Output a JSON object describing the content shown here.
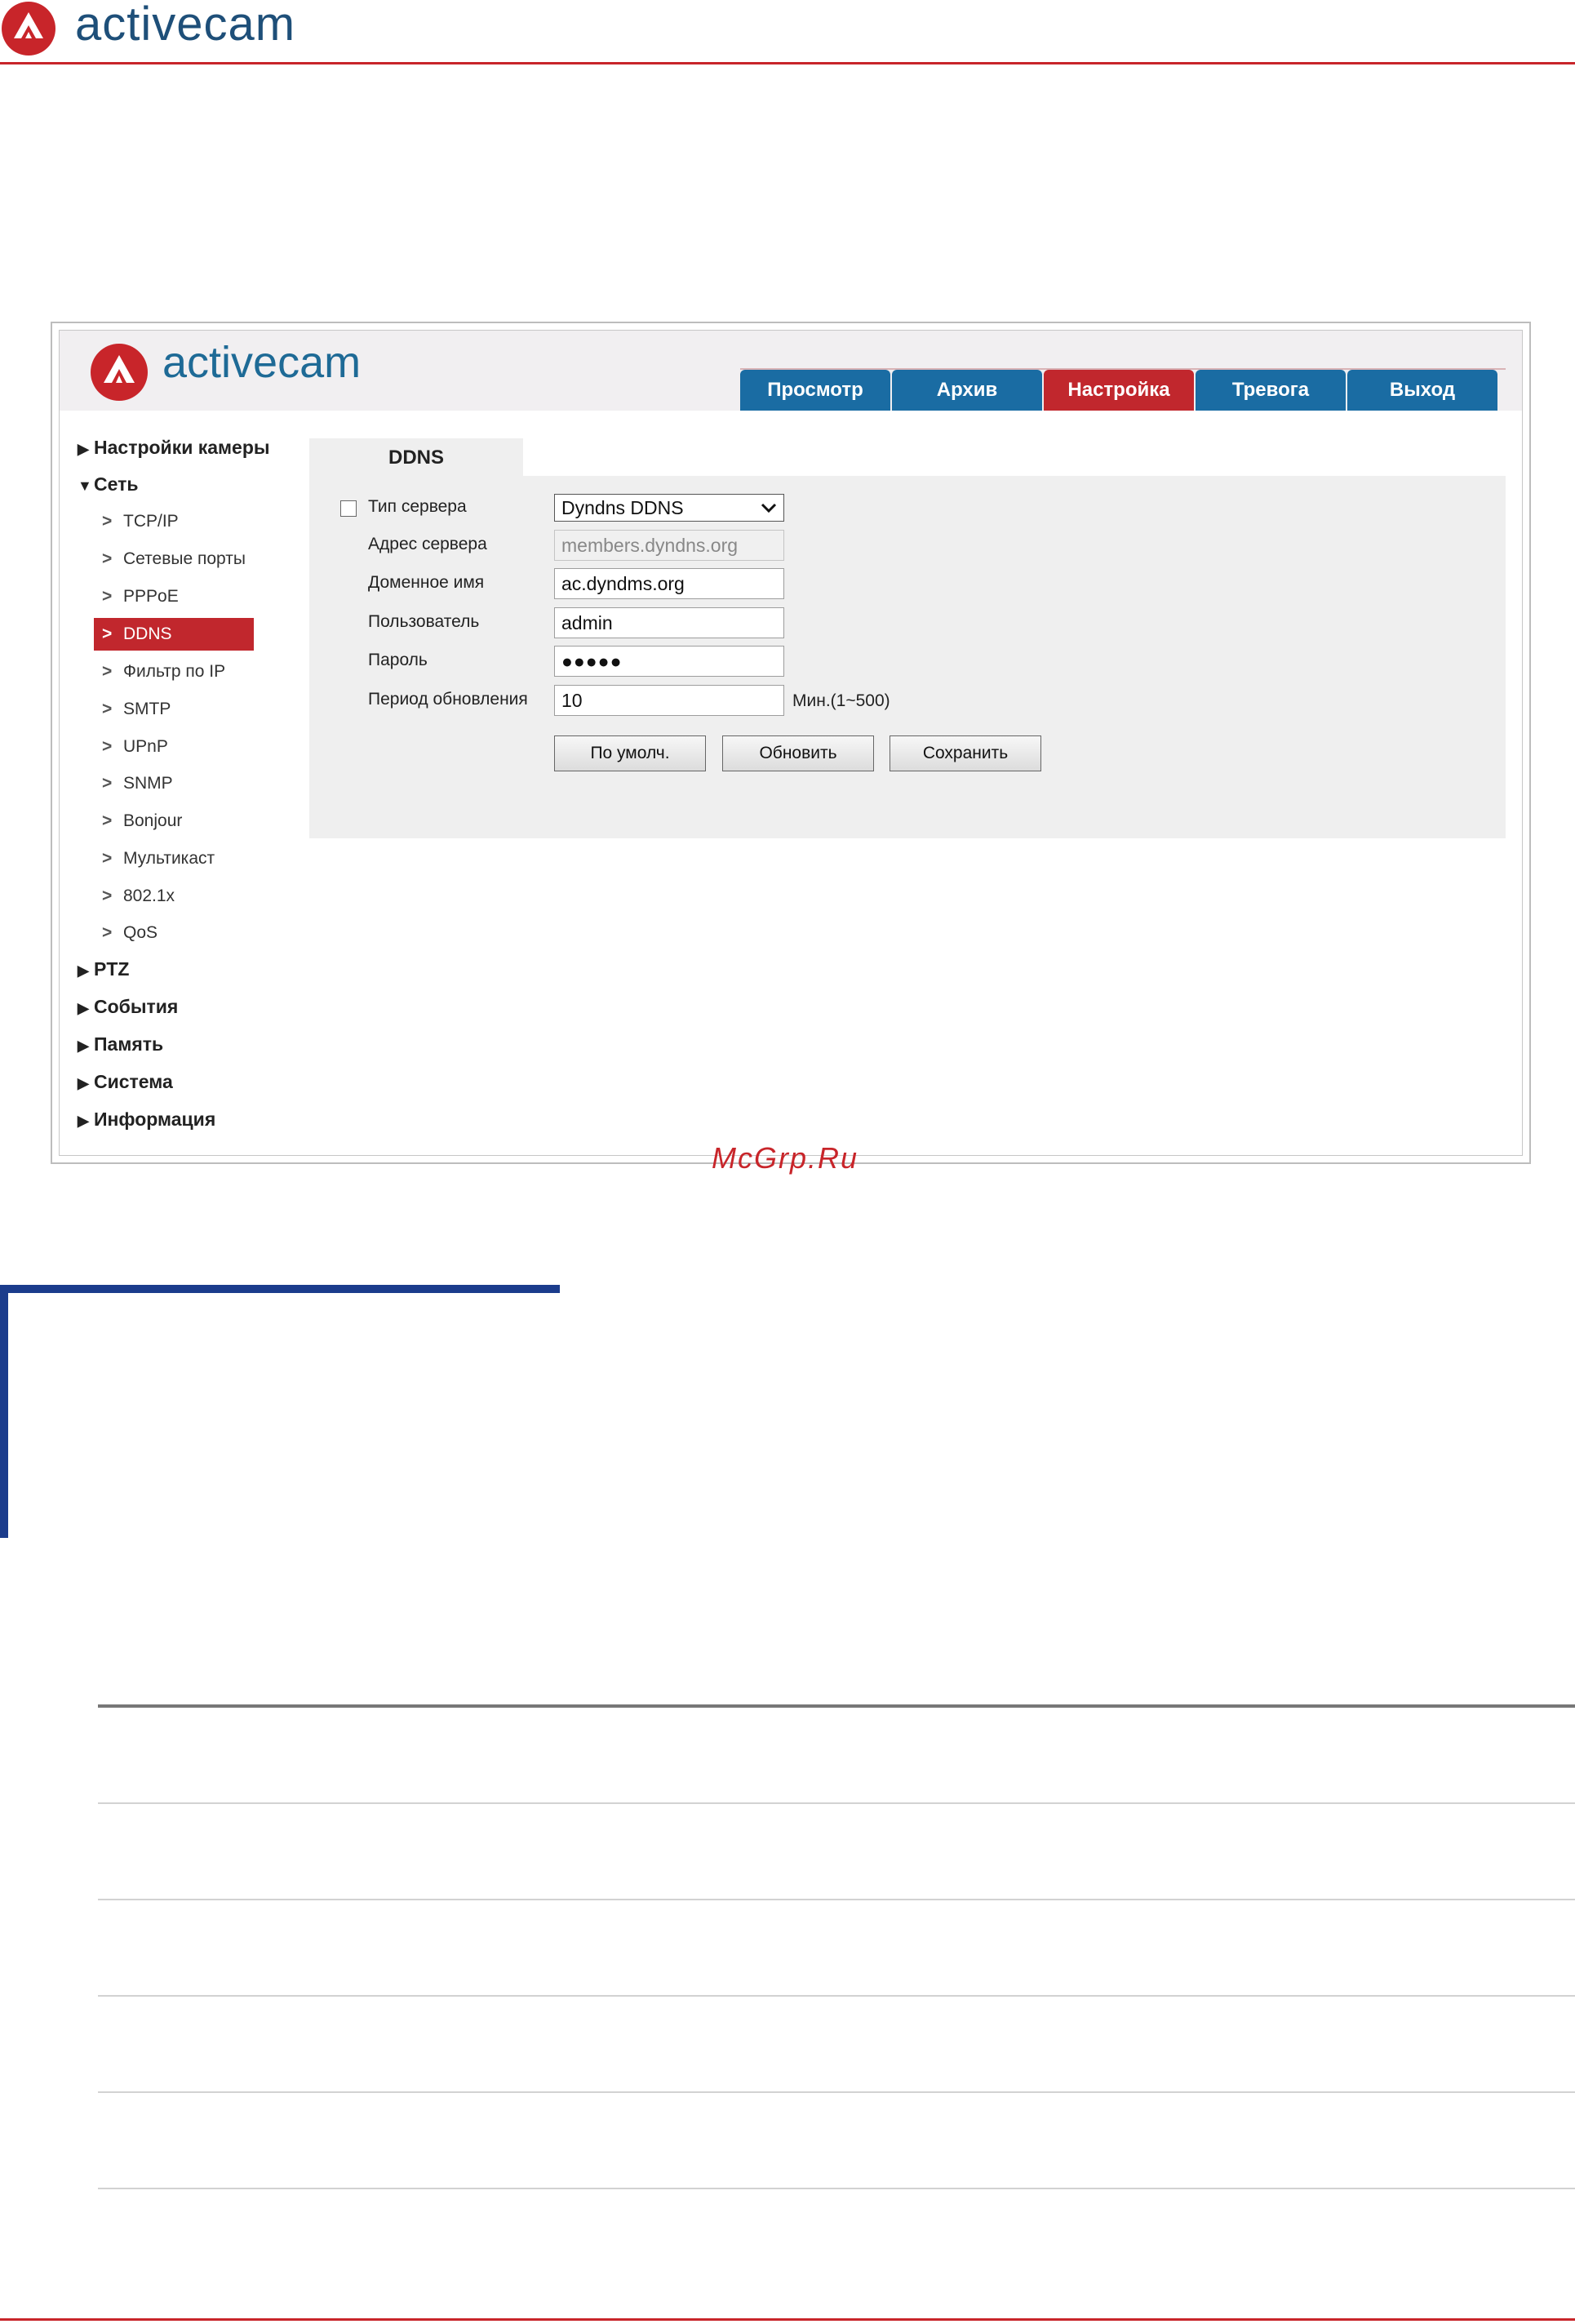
{
  "document": {
    "brand": "activecam",
    "watermark": "McGrp.Ru",
    "colors": {
      "brand_red": "#c8252a",
      "brand_blue": "#1e4f79",
      "section_accent": "#1b3c8c"
    }
  },
  "camera_ui": {
    "brand": "activecam",
    "tabs": [
      {
        "label": "Просмотр",
        "active": false
      },
      {
        "label": "Архив",
        "active": false
      },
      {
        "label": "Настройка",
        "active": true
      },
      {
        "label": "Тревога",
        "active": false
      },
      {
        "label": "Выход",
        "active": false
      }
    ],
    "sidebar": {
      "groups": [
        {
          "label": "Настройки камеры",
          "expanded": false
        },
        {
          "label": "Сеть",
          "expanded": true
        },
        {
          "label": "PTZ",
          "expanded": false
        },
        {
          "label": "События",
          "expanded": false
        },
        {
          "label": "Память",
          "expanded": false
        },
        {
          "label": "Система",
          "expanded": false
        },
        {
          "label": "Информация",
          "expanded": false
        }
      ],
      "network_items": [
        {
          "label": "TCP/IP"
        },
        {
          "label": "Сетевые порты"
        },
        {
          "label": "PPPoE"
        },
        {
          "label": "DDNS",
          "active": true
        },
        {
          "label": "Фильтр по IP"
        },
        {
          "label": "SMTP"
        },
        {
          "label": "UPnP"
        },
        {
          "label": "SNMP"
        },
        {
          "label": "Bonjour"
        },
        {
          "label": "Мультикаст"
        },
        {
          "label": "802.1x"
        },
        {
          "label": "QoS"
        }
      ]
    },
    "panel": {
      "tab_title": "DDNS",
      "server_type": {
        "label": "Тип сервера",
        "checked": false,
        "value": "Dyndns DDNS"
      },
      "server_address": {
        "label": "Адрес сервера",
        "value": "members.dyndns.org"
      },
      "domain_name": {
        "label": "Доменное имя",
        "value": "ac.dyndms.org"
      },
      "user": {
        "label": "Пользователь",
        "value": "admin"
      },
      "password": {
        "label": "Пароль",
        "value": "●●●●●"
      },
      "update_period": {
        "label": "Период обновления",
        "value": "10",
        "unit": "Мин.(1~500)"
      },
      "buttons": {
        "default": "По умолч.",
        "refresh": "Обновить",
        "save": "Сохранить"
      }
    },
    "colors": {
      "tab_blue": "#1a6ca3",
      "tab_active": "#c1272d",
      "panel_bg": "#efefef"
    }
  }
}
